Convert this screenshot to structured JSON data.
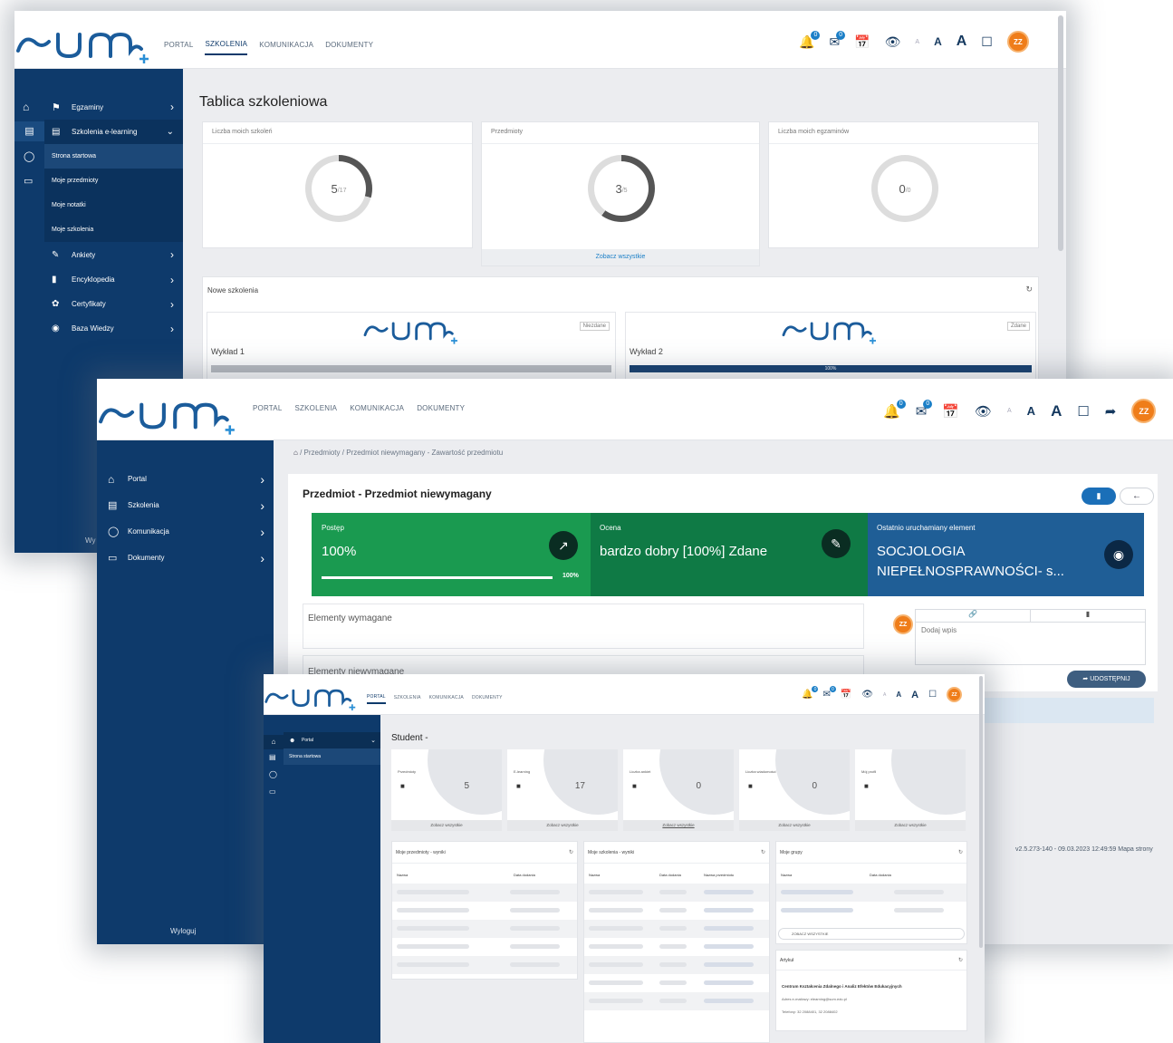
{
  "brand": {
    "logo_text": "sum+"
  },
  "win1": {
    "nav": [
      "PORTAL",
      "SZKOLENIA",
      "KOMUNIKACJA",
      "DOKUMENTY"
    ],
    "nav_active": "SZKOLENIA",
    "badges": {
      "notifications": "0",
      "messages": "0"
    },
    "font_sizes": [
      "A",
      "A",
      "A"
    ],
    "avatar": "ZZ",
    "sidebar": [
      {
        "label": "Egzaminy",
        "icon": "graduation-cap-icon"
      },
      {
        "label": "Szkolenia e-learning",
        "icon": "laptop-icon",
        "expanded": true
      },
      {
        "label": "Strona startowa",
        "sub": true,
        "active": true
      },
      {
        "label": "Moje przedmioty",
        "sub": true
      },
      {
        "label": "Moje notatki",
        "sub": true
      },
      {
        "label": "Moje szkolenia",
        "sub": true
      },
      {
        "label": "Ankiety",
        "icon": "survey-icon"
      },
      {
        "label": "Encyklopedia",
        "icon": "book-icon"
      },
      {
        "label": "Certyfikaty",
        "icon": "certificate-icon"
      },
      {
        "label": "Baza Wiedzy",
        "icon": "globe-icon"
      }
    ],
    "sidebar_footer_partial": "Wy",
    "page_title": "Tablica szkoleniowa",
    "cards": [
      {
        "title": "Liczba moich szkoleń",
        "value": "5",
        "total": "/17",
        "progress": 0.294
      },
      {
        "title": "Przedmioty",
        "value": "3",
        "total": "/5",
        "progress": 0.6,
        "footer": "Zobacz wszystkie"
      },
      {
        "title": "Liczba moich egzaminów",
        "value": "0",
        "total": "/0",
        "progress": 0
      }
    ],
    "new_trainings": {
      "title": "Nowe szkolenia",
      "items": [
        {
          "name": "Wykład 1",
          "status": "Niezdane",
          "progress": 0,
          "progress_label": ""
        },
        {
          "name": "Wykład 2",
          "status": "Zdane",
          "progress": 1,
          "progress_label": "100%"
        }
      ]
    }
  },
  "win2": {
    "nav": [
      "PORTAL",
      "SZKOLENIA",
      "KOMUNIKACJA",
      "DOKUMENTY"
    ],
    "badges": {
      "notifications": "0",
      "messages": "0"
    },
    "font_sizes": [
      "A",
      "A",
      "A"
    ],
    "avatar": "ZZ",
    "sidebar": [
      {
        "label": "Portal",
        "icon": "home-icon"
      },
      {
        "label": "Szkolenia",
        "icon": "laptop-icon"
      },
      {
        "label": "Komunikacja",
        "icon": "chat-icon"
      },
      {
        "label": "Dokumenty",
        "icon": "folder-icon"
      }
    ],
    "logout": "Wyloguj",
    "breadcrumb": [
      "Przedmioty",
      "Przedmiot niewymagany - Zawartość przedmiotu"
    ],
    "title": "Przedmiot - Przedmiot niewymagany",
    "tiles": [
      {
        "label": "Postęp",
        "value": "100%",
        "bar_label": "100%",
        "progress": 1,
        "color": "#1a9a50",
        "icon": "chart-icon"
      },
      {
        "label": "Ocena",
        "value": "bardzo dobry [100%] Zdane",
        "color": "#0f7a45",
        "icon": "edit-icon"
      },
      {
        "label": "Ostatnio uruchamiany element",
        "value": "SOCJOLOGIA NIEPEŁNOSPRAWNOŚCI- s...",
        "color": "#1f5e96",
        "icon": "eye-icon"
      }
    ],
    "sections": [
      "Elementy wymagane",
      "Elementy niewymagane"
    ],
    "comment_placeholder": "Dodaj wpis",
    "share_button": "UDOSTĘPNIJ",
    "footer": "v2.5.273-140 - 09.03.2023 12:49:59 Mapa strony"
  },
  "win3": {
    "nav": [
      "PORTAL",
      "SZKOLENIA",
      "KOMUNIKACJA",
      "DOKUMENTY"
    ],
    "nav_active": "PORTAL",
    "badges": {
      "notifications": "0",
      "messages": "0"
    },
    "font_sizes": [
      "A",
      "A",
      "A"
    ],
    "avatar": "ZZ",
    "sidebar": [
      {
        "label": "Portal",
        "icon": "users-icon",
        "expanded": true
      },
      {
        "label": "Strona startowa",
        "sub": true
      }
    ],
    "title": "Student -",
    "stats": [
      {
        "label": "Przedmioty",
        "value": "5",
        "icon": "branch-icon",
        "link": "Zobacz wszystkie"
      },
      {
        "label": "E-learning",
        "value": "17",
        "icon": "laptop-icon",
        "link": "Zobacz wszystkie"
      },
      {
        "label": "Liczba ankiet",
        "value": "0",
        "icon": "survey-icon",
        "link": "Zobacz wszystkie"
      },
      {
        "label": "Liczba wiadomości",
        "value": "0",
        "icon": "envelope-icon",
        "link": "Zobacz wszystkie"
      },
      {
        "label": "Mój profil",
        "value": "",
        "icon": "user-icon",
        "link": "Zobacz wszystkie"
      }
    ],
    "panels": {
      "subjects": {
        "title": "Moje przedmioty - wyniki",
        "cols": [
          "Nazwa",
          "Data dodania"
        ]
      },
      "trainings": {
        "title": "Moje szkolenia - wyniki",
        "cols": [
          "Nazwa",
          "Data dodania",
          "Nazwa przedmiotu"
        ]
      },
      "groups": {
        "title": "Moje grupy",
        "cols": [
          "Nazwa",
          "Data dodania"
        ],
        "button": "ZOBACZ WSZYSTKIE"
      },
      "articles": {
        "title": "Artykuł",
        "org": "Centrum Kształcenia Zdalnego i Analiz Efektów Edukacyjnych",
        "email": "Adres e-mailowy: elearning@sum.edu.pl",
        "phone": "Telefony: 32 2088401, 32 2088402"
      }
    }
  },
  "colors": {
    "navy": "#0e3a6b",
    "orange": "#ef7d1a",
    "green": "#1a9a50",
    "blue": "#1f5e96",
    "link": "#1b7fc7"
  }
}
